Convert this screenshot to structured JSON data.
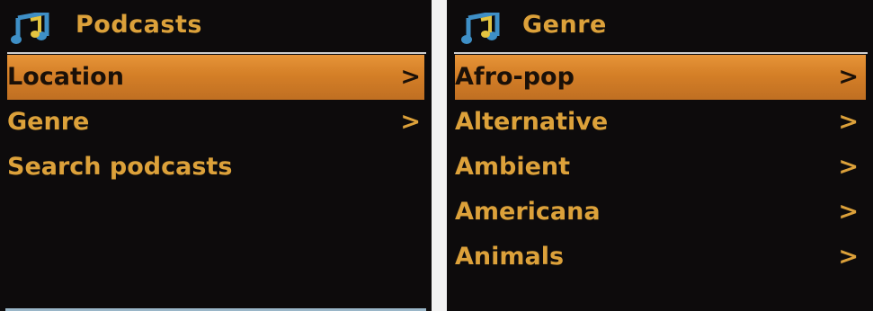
{
  "panels": [
    {
      "title": "Podcasts",
      "icon": "music-note-icon",
      "items": [
        {
          "label": "Location",
          "chevron": ">"
        },
        {
          "label": "Genre",
          "chevron": ">"
        },
        {
          "label": "Search podcasts",
          "chevron": ""
        }
      ]
    },
    {
      "title": "Genre",
      "icon": "music-note-icon",
      "items": [
        {
          "label": "Afro-pop",
          "chevron": ">"
        },
        {
          "label": "Alternative",
          "chevron": ">"
        },
        {
          "label": "Ambient",
          "chevron": ">"
        },
        {
          "label": "Americana",
          "chevron": ">"
        },
        {
          "label": "Animals",
          "chevron": ">"
        }
      ]
    }
  ],
  "colors": {
    "screen_bg": "#0d0b0c",
    "text": "#dca13a",
    "highlight": "#d47f27",
    "icon_blue": "#3e8fc6",
    "icon_yellow": "#e3c440"
  }
}
